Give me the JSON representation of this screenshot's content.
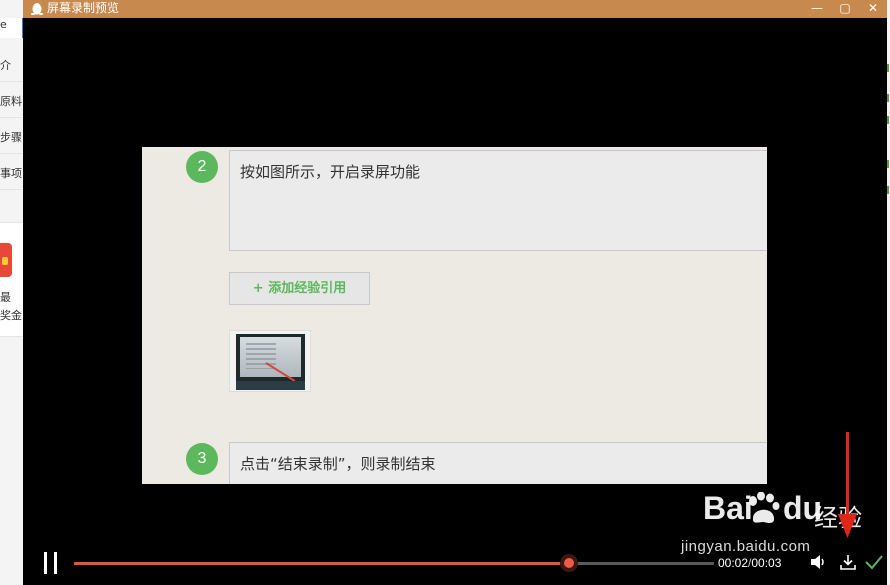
{
  "background_page": {
    "tab_text": "e",
    "rows": [
      "介",
      "原料",
      "步骤",
      "事项"
    ],
    "promo_lines": [
      "最",
      "奖金"
    ]
  },
  "window": {
    "title": "屏幕录制预览",
    "min_glyph": "—",
    "max_glyph": "▢",
    "close_glyph": "✕",
    "accent": "#c8894f"
  },
  "video": {
    "steps": [
      {
        "number": "2",
        "text": "按如图所示，开启录屏功能"
      },
      {
        "number": "3",
        "text": "点击“结束录制”，则录制结束"
      }
    ],
    "add_ref_label": "+ 添加经验引用"
  },
  "watermark": {
    "bai": "Bai",
    "du": "du",
    "jingyan": "经验",
    "url": "jingyan.baidu.com"
  },
  "player": {
    "current_time": "00:02",
    "separator": "/",
    "total_time": "00:03",
    "progress_fraction": 0.773,
    "progress_color": "#e8513f",
    "confirm_color": "#5cb85c",
    "icons": [
      "pause-icon",
      "volume-icon",
      "download-icon",
      "check-icon"
    ]
  }
}
